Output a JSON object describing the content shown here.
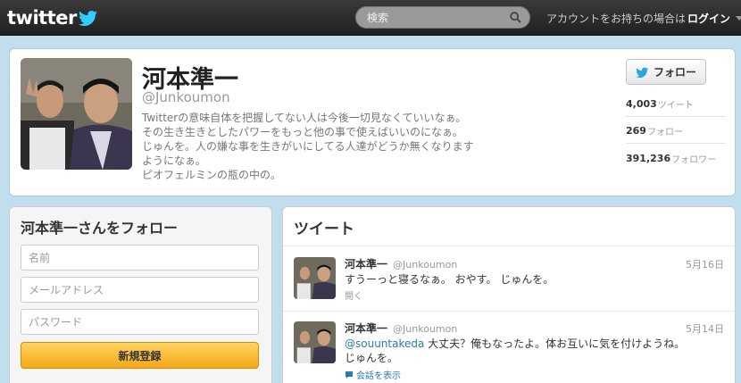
{
  "header": {
    "logo": "twitter",
    "search_placeholder": "検索",
    "login_prompt": "アカウントをお持ちの場合は",
    "login_link": "ログイン"
  },
  "profile": {
    "display_name": "河本準一",
    "handle": "@Junkoumon",
    "bio_lines": [
      "Twitterの意味自体を把握してない人は今後一切見なくていいなぁ。",
      "その生き生きとしたパワーをもっと他の事で使えばいいのになぁ。",
      "じゅんを。人の嫌な事を生きがいにしてる人達がどうか無くなります",
      "ようになぁ。",
      "ピオフェルミンの瓶の中の。"
    ],
    "follow_label": "フォロー",
    "stats": [
      {
        "value": "4,003",
        "label": "ツイート"
      },
      {
        "value": "269",
        "label": "フォロー"
      },
      {
        "value": "391,236",
        "label": "フォロワー"
      }
    ]
  },
  "signup": {
    "title": "河本準一さんをフォロー",
    "name_placeholder": "名前",
    "email_placeholder": "メールアドレス",
    "password_placeholder": "パスワード",
    "register_label": "新規登録"
  },
  "tweets": {
    "title": "ツイート",
    "items": [
      {
        "name": "河本準一",
        "username": "@Junkoumon",
        "date": "5月16日",
        "mention": "",
        "text_line1": "すうーっと寝るなぁ。 おやす。 じゅんを。",
        "text_line2": "",
        "action": "開く"
      },
      {
        "name": "河本準一",
        "username": "@Junkoumon",
        "date": "5月14日",
        "mention": "@souuntakeda",
        "text_line1": " 大丈夫？俺もなったよ。体お互いに気を付けようね。",
        "text_line2": "じゅんを。",
        "action": "会話を表示"
      }
    ]
  },
  "colors": {
    "background": "#c0deed",
    "topbar": "#2b2b2b",
    "link": "#2a7ab0",
    "register_button": "#f5a818"
  }
}
